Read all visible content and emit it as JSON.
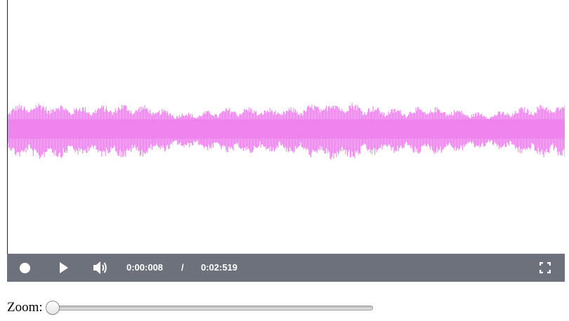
{
  "player": {
    "waveform_color": "#ee82ee",
    "controls_bg": "#6c717b",
    "record_icon": "record-icon",
    "play_icon": "play-icon",
    "volume_icon": "volume-icon",
    "fullscreen_icon": "fullscreen-icon",
    "current_time": "0:00:008",
    "separator": "/",
    "duration": "0:02:519"
  },
  "zoom": {
    "label": "Zoom:",
    "value": 0
  }
}
